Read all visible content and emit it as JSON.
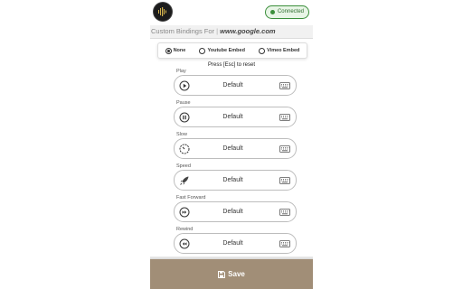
{
  "header": {
    "logo_icon": "waveform-logo-icon",
    "status_label": "Connected",
    "status_color": "#3b8f3b"
  },
  "binding": {
    "label": "Custom Bindings For",
    "separator": "|",
    "site": "www.google.com"
  },
  "embed_options": [
    {
      "label": "None",
      "selected": true
    },
    {
      "label": "Youtube Embed",
      "selected": false
    },
    {
      "label": "Vimeo Embed",
      "selected": false
    }
  ],
  "hint": "Press [Esc] to reset",
  "bindings": [
    {
      "label": "Play",
      "value": "Default",
      "icon": "play-icon"
    },
    {
      "label": "Pause",
      "value": "Default",
      "icon": "pause-icon"
    },
    {
      "label": "Slow",
      "value": "Default",
      "icon": "slow-gauge-icon"
    },
    {
      "label": "Speed",
      "value": "Default",
      "icon": "rocket-icon"
    },
    {
      "label": "Fast Forward",
      "value": "Default",
      "icon": "fast-forward-icon"
    },
    {
      "label": "Rewind",
      "value": "Default",
      "icon": "rewind-icon"
    }
  ],
  "footer": {
    "save_label": "Save",
    "save_icon": "floppy-disk-icon",
    "background": "#a18e77"
  }
}
